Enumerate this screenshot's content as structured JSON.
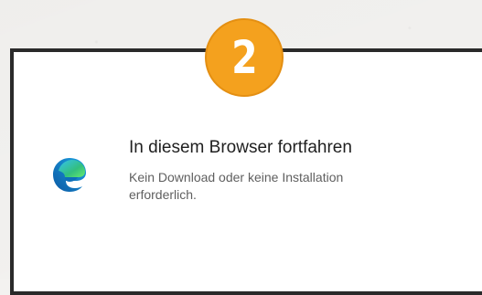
{
  "step": {
    "number": "2",
    "color": "#f4a11e"
  },
  "option": {
    "icon": "edge-browser-icon",
    "title": "In diesem Browser fortfahren",
    "description": "Kein Download oder keine Installation erforderlich."
  },
  "colors": {
    "panel_border": "#2a2a2a",
    "title_text": "#1f1f1f",
    "description_text": "#5f5f5f"
  }
}
